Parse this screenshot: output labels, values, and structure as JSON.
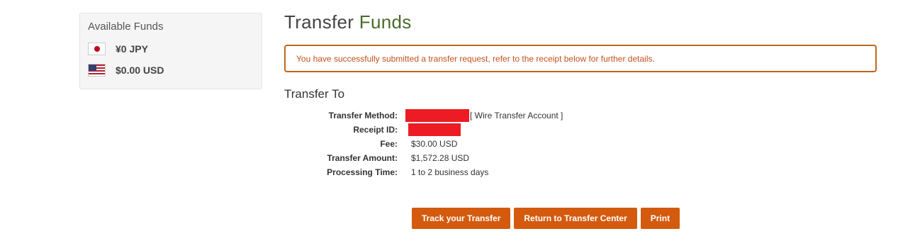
{
  "sidebar": {
    "title": "Available Funds",
    "funds": [
      {
        "flag_icon": "japan-flag-icon",
        "amount": "¥0 JPY"
      },
      {
        "flag_icon": "us-flag-icon",
        "amount": "$0.00 USD"
      }
    ]
  },
  "page": {
    "title_part1": "Transfer ",
    "title_part2": "Funds",
    "accent_color": "#4a6b2a"
  },
  "alert": {
    "message": "You have successfully submitted a transfer request, refer to the receipt below for further details.",
    "color": "#c2511a"
  },
  "transfer_to": {
    "heading": "Transfer To",
    "rows": [
      {
        "label": "Transfer Method:",
        "value": "[ Wire Transfer Account ]",
        "redacted": true
      },
      {
        "label": "Receipt ID:",
        "value": "",
        "redacted": true
      },
      {
        "label": "Fee:",
        "value": "$30.00 USD"
      },
      {
        "label": "Transfer Amount:",
        "value": "$1,572.28 USD"
      },
      {
        "label": "Processing Time:",
        "value": "1 to 2 business days"
      }
    ]
  },
  "buttons": {
    "track": "Track your Transfer",
    "return": "Return to Transfer Center",
    "print": "Print",
    "color": "#d45a0e"
  }
}
